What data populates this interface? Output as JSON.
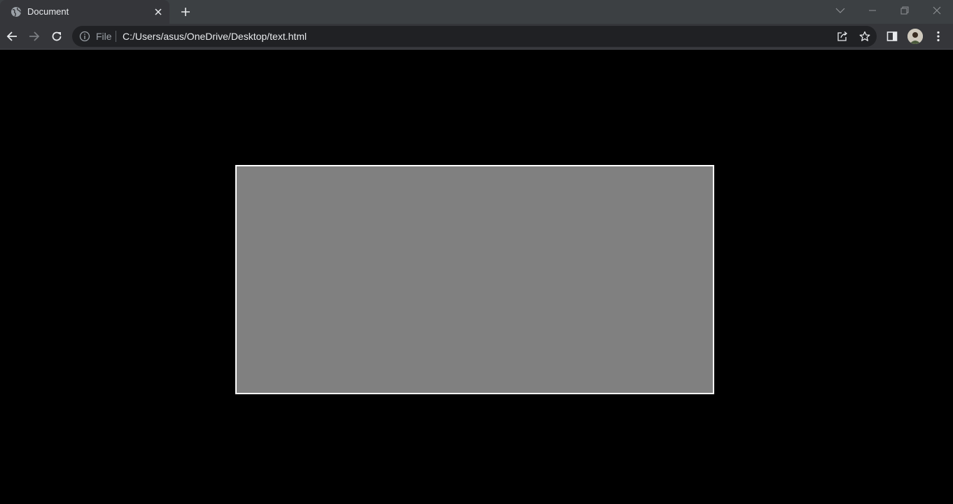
{
  "browser": {
    "tab": {
      "title": "Document",
      "favicon": "globe-icon",
      "close_icon": "close-icon"
    },
    "new_tab_icon": "plus-icon",
    "window_controls": [
      "chevron-down-icon",
      "minimize-icon",
      "restore-icon",
      "close-icon"
    ],
    "toolbar": {
      "back_icon": "arrow-left-icon",
      "forward_icon": "arrow-right-icon",
      "reload_icon": "reload-icon",
      "omnibox": {
        "security_icon": "info-icon",
        "scheme_label": "File",
        "url": "C:/Users/asus/OneDrive/Desktop/text.html",
        "share_icon": "share-icon",
        "bookmark_icon": "star-icon"
      },
      "side_panel_icon": "side-panel-icon",
      "profile_icon": "avatar",
      "menu_icon": "kebab-menu-icon"
    }
  },
  "page": {
    "background_color": "#000000",
    "box": {
      "fill_color": "#808080",
      "border_color": "#ffffff"
    }
  },
  "theme": {
    "tabstrip_bg": "#3c4043",
    "toolbar_bg": "#35363a",
    "omnibox_bg": "#202124",
    "text_primary": "#e8eaed",
    "text_secondary": "#9aa0a6"
  }
}
